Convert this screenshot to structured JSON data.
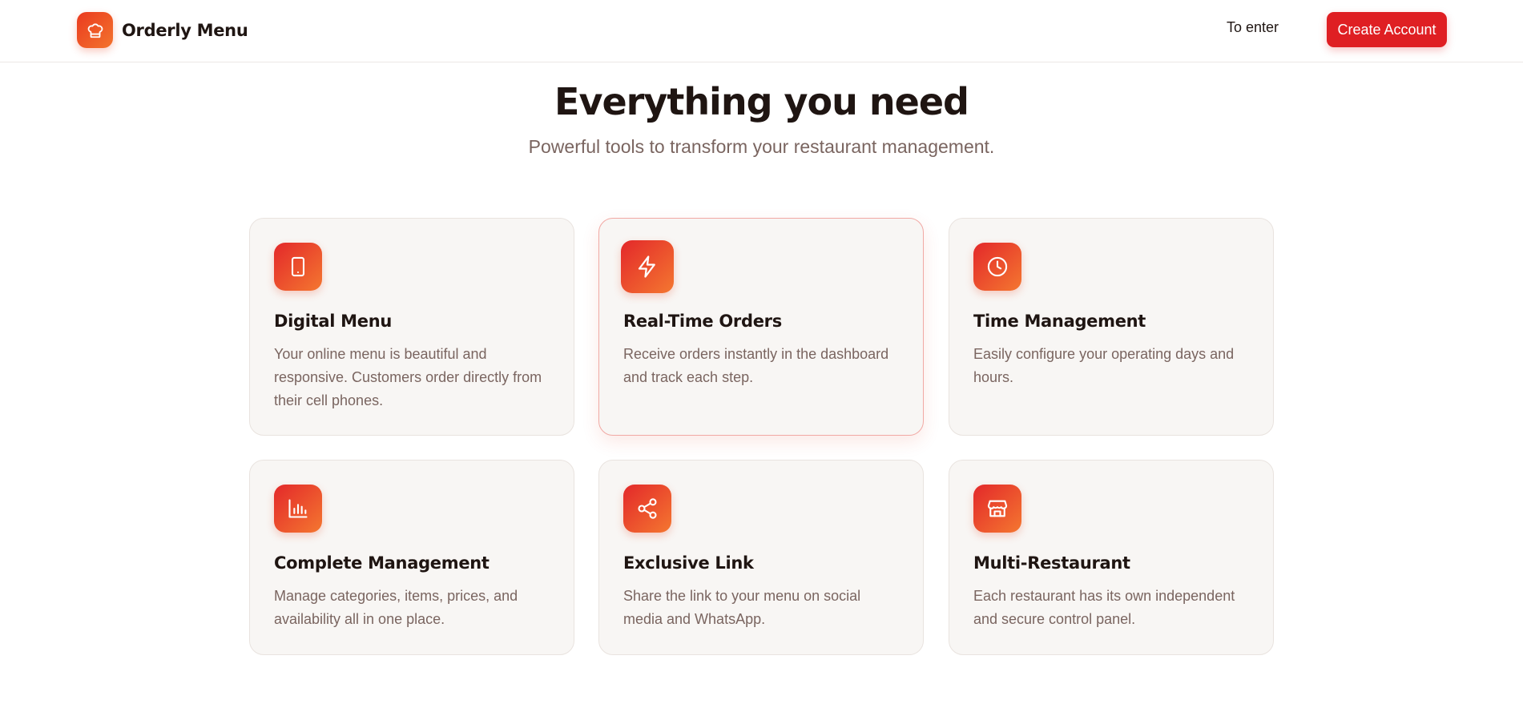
{
  "header": {
    "brand_name": "Orderly Menu",
    "brand_icon": "chef-hat-icon",
    "login_label": "To enter",
    "create_account_label": "Create Account"
  },
  "hero": {
    "title": "Everything you need",
    "subtitle": "Powerful tools to transform your restaurant management."
  },
  "features": [
    {
      "icon": "smartphone-icon",
      "title": "Digital Menu",
      "description": "Your online menu is beautiful and responsive. Customers order directly from their cell phones."
    },
    {
      "icon": "lightning-icon",
      "title": "Real-Time Orders",
      "description": "Receive orders instantly in the dashboard and track each step."
    },
    {
      "icon": "clock-icon",
      "title": "Time Management",
      "description": "Easily configure your operating days and hours."
    },
    {
      "icon": "bar-chart-icon",
      "title": "Complete Management",
      "description": "Manage categories, items, prices, and availability all in one place."
    },
    {
      "icon": "share-icon",
      "title": "Exclusive Link",
      "description": "Share the link to your menu on social media and WhatsApp."
    },
    {
      "icon": "store-icon",
      "title": "Multi-Restaurant",
      "description": "Each restaurant has its own independent and secure control panel."
    }
  ],
  "colors": {
    "brand_red": "#df1f23",
    "gradient_start": "#e3282a",
    "gradient_end": "#f47730",
    "heading": "#1f1512",
    "muted_text": "#7a6560",
    "card_bg": "#f8f6f4"
  }
}
